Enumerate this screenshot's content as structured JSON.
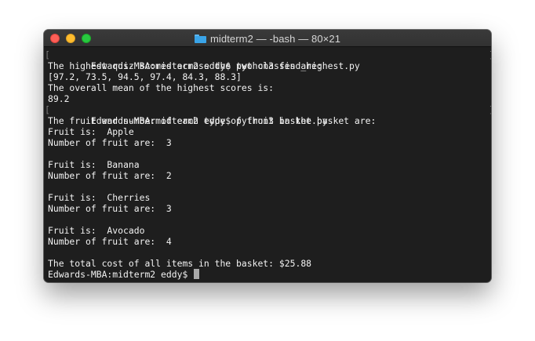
{
  "window": {
    "title": "midterm2 — -bash — 80×21",
    "folder_color": "#3aa4e8"
  },
  "terminal": {
    "background": "#1e1e1e",
    "text_color": "#f2f2f2",
    "lines": [
      "Edwards-MBA:midterm2 eddy$ python3 find_highest.py",
      "The highest quiz scores across the two classes are:",
      "[97.2, 73.5, 94.5, 97.4, 84.3, 88.3]",
      "The overall mean of the highest scores is:",
      "89.2",
      "Edwards-MBA:midterm2 eddy$ python3 basket.py",
      "The fruit and number of each type of fruit in the basket are:",
      "Fruit is:  Apple",
      "Number of fruit are:  3",
      "",
      "Fruit is:  Banana",
      "Number of fruit are:  2",
      "",
      "Fruit is:  Cherries",
      "Number of fruit are:  3",
      "",
      "Fruit is:  Avocado",
      "Number of fruit are:  4",
      "",
      "The total cost of all items in the basket: $25.88",
      "Edwards-MBA:midterm2 eddy$ "
    ]
  }
}
